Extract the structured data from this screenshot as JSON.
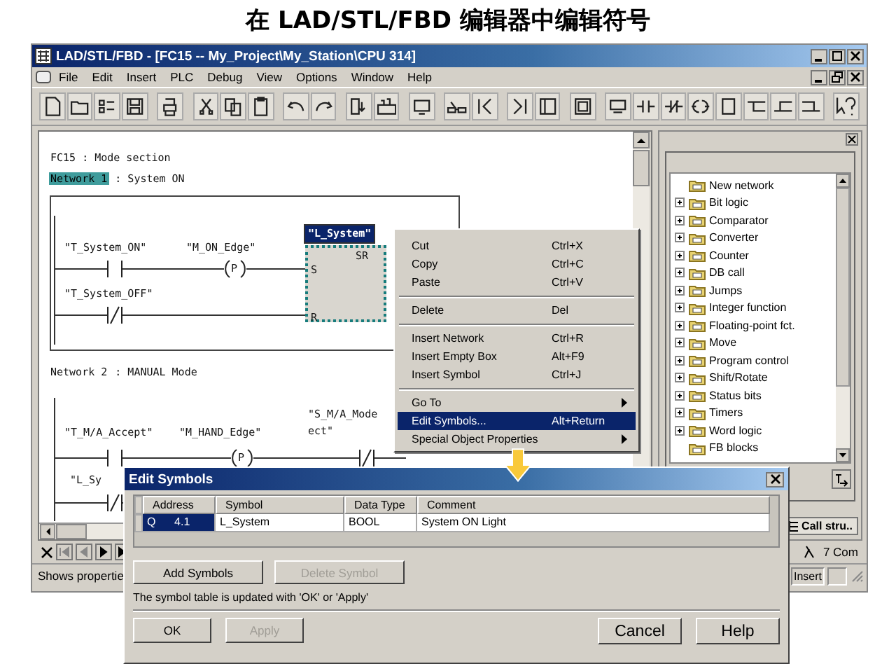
{
  "slide_title": "在 LAD/STL/FBD 编辑器中编辑符号",
  "window": {
    "title": "LAD/STL/FBD  - [FC15 -- My_Project\\My_Station\\CPU 314]"
  },
  "menu": [
    "File",
    "Edit",
    "Insert",
    "PLC",
    "Debug",
    "View",
    "Options",
    "Window",
    "Help"
  ],
  "editor": {
    "block_title": "FC15 : Mode section",
    "networks": [
      {
        "number": "Network 1",
        "title": ": System ON",
        "selected": true,
        "elements": [
          {
            "kind": "no_contact",
            "labels": [
              "\"T_System_ON\""
            ]
          },
          {
            "kind": "edge",
            "labels": [
              "\"M_ON_Edge\""
            ],
            "symbol": "P"
          },
          {
            "kind": "sr_box",
            "labels": [
              "\"L_System\""
            ],
            "selected": true,
            "type": "SR",
            "inputs": [
              "S",
              "R"
            ]
          },
          {
            "kind": "nc_contact",
            "labels": [
              "\"T_System_OFF\""
            ]
          }
        ]
      },
      {
        "number": "Network 2",
        "title": ": MANUAL Mode",
        "selected": false,
        "elements": [
          {
            "kind": "no_contact",
            "labels": [
              "\"T_M/A_Accept\""
            ]
          },
          {
            "kind": "edge",
            "labels": [
              "\"M_HAND_Edge\""
            ],
            "symbol": "P"
          },
          {
            "kind": "nc_contact",
            "labels": [
              "\"S_M/A_Mode",
              "ect\""
            ]
          },
          {
            "kind": "nc_contact",
            "labels": [
              "\"L_Sy"
            ]
          }
        ]
      }
    ]
  },
  "elements_panel": {
    "items": [
      {
        "label": "New network",
        "expandable": false
      },
      {
        "label": "Bit logic",
        "expandable": true
      },
      {
        "label": "Comparator",
        "expandable": true
      },
      {
        "label": "Converter",
        "expandable": true
      },
      {
        "label": "Counter",
        "expandable": true
      },
      {
        "label": "DB call",
        "expandable": true
      },
      {
        "label": "Jumps",
        "expandable": true
      },
      {
        "label": "Integer function",
        "expandable": true
      },
      {
        "label": "Floating-point fct.",
        "expandable": true
      },
      {
        "label": "Move",
        "expandable": true
      },
      {
        "label": "Program control",
        "expandable": true
      },
      {
        "label": "Shift/Rotate",
        "expandable": true
      },
      {
        "label": "Status bits",
        "expandable": true
      },
      {
        "label": "Timers",
        "expandable": true
      },
      {
        "label": "Word logic",
        "expandable": true
      },
      {
        "label": "FB blocks",
        "expandable": false
      }
    ],
    "tab": "Call stru.."
  },
  "context_menu": {
    "items": [
      {
        "kind": "item",
        "label": "Cut",
        "shortcut": "Ctrl+X",
        "submenu": false,
        "selected": false
      },
      {
        "kind": "item",
        "label": "Copy",
        "shortcut": "Ctrl+C",
        "submenu": false,
        "selected": false
      },
      {
        "kind": "item",
        "label": "Paste",
        "shortcut": "Ctrl+V",
        "submenu": false,
        "selected": false
      },
      {
        "kind": "separator"
      },
      {
        "kind": "item",
        "label": "Delete",
        "shortcut": "Del",
        "submenu": false,
        "selected": false
      },
      {
        "kind": "separator"
      },
      {
        "kind": "item",
        "label": "Insert Network",
        "shortcut": "Ctrl+R",
        "submenu": false,
        "selected": false
      },
      {
        "kind": "item",
        "label": "Insert Empty Box",
        "shortcut": "Alt+F9",
        "submenu": false,
        "selected": false
      },
      {
        "kind": "item",
        "label": "Insert Symbol",
        "shortcut": "Ctrl+J",
        "submenu": false,
        "selected": false
      },
      {
        "kind": "separator"
      },
      {
        "kind": "item",
        "label": "Go To",
        "submenu": true,
        "selected": false
      },
      {
        "kind": "item",
        "label": "Edit Symbols...",
        "shortcut": "Alt+Return",
        "submenu": false,
        "selected": true
      },
      {
        "kind": "item",
        "label": "Special Object Properties",
        "submenu": true,
        "selected": false
      }
    ]
  },
  "nav_panel_label": "7 Com",
  "status_bar": {
    "hint": "Shows propertie",
    "mode": "Insert"
  },
  "dialog": {
    "title": "Edit Symbols",
    "columns": [
      "Address",
      "Symbol",
      "Data Type",
      "Comment"
    ],
    "rows": [
      {
        "cells": [
          {
            "text": "Q      4.1",
            "selected": true
          },
          {
            "text": "L_System",
            "selected": false
          },
          {
            "text": "BOOL",
            "selected": false
          },
          {
            "text": "System ON Light",
            "selected": false
          }
        ]
      }
    ],
    "buttons": [
      {
        "label": "Add Symbols",
        "disabled": false
      },
      {
        "label": "Delete Symbol",
        "disabled": true
      }
    ],
    "note": "The symbol table is updated with 'OK' or 'Apply'",
    "footer_buttons": [
      {
        "label": "OK",
        "disabled": false,
        "kind": "compact"
      },
      {
        "label": "Apply",
        "disabled": true,
        "kind": "compact"
      },
      {
        "label": "Cancel",
        "disabled": false,
        "kind": "standard"
      },
      {
        "label": "Help",
        "disabled": false,
        "kind": "standard"
      }
    ]
  }
}
